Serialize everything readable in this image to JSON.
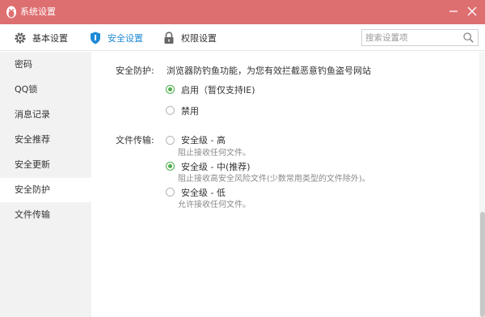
{
  "window": {
    "title": "系统设置",
    "accent": "#de6f71"
  },
  "toolbar": {
    "tabs": [
      {
        "label": "基本设置",
        "icon": "gear-icon"
      },
      {
        "label": "安全设置",
        "icon": "shield-icon",
        "active": true
      },
      {
        "label": "权限设置",
        "icon": "lock-icon"
      }
    ],
    "search_placeholder": "搜索设置项"
  },
  "sidebar": {
    "items": [
      {
        "label": "密码"
      },
      {
        "label": "QQ锁"
      },
      {
        "label": "消息记录"
      },
      {
        "label": "安全推荐"
      },
      {
        "label": "安全更新"
      },
      {
        "label": "安全防护",
        "active": true
      },
      {
        "label": "文件传输"
      }
    ]
  },
  "main": {
    "protection": {
      "label": "安全防护:",
      "description": "浏览器防钓鱼功能，为您有效拦截恶意钓鱼盗号网站",
      "options": [
        {
          "label": "启用（暂仅支持IE)",
          "checked": true
        },
        {
          "label": "禁用",
          "checked": false
        }
      ]
    },
    "transfer": {
      "label": "文件传输:",
      "options": [
        {
          "label": "安全级 - 高",
          "sub": "阻止接收任何文件。",
          "checked": false
        },
        {
          "label": "安全级 - 中(推荐)",
          "sub": "阻止接收高安全风险文件(少数常用类型的文件除外)。",
          "checked": true
        },
        {
          "label": "安全级 - 低",
          "sub": "允许接收任何文件。",
          "checked": false
        }
      ]
    }
  },
  "colors": {
    "radio_checked": "#4fae4b",
    "active_tab": "#1e8ad6"
  }
}
